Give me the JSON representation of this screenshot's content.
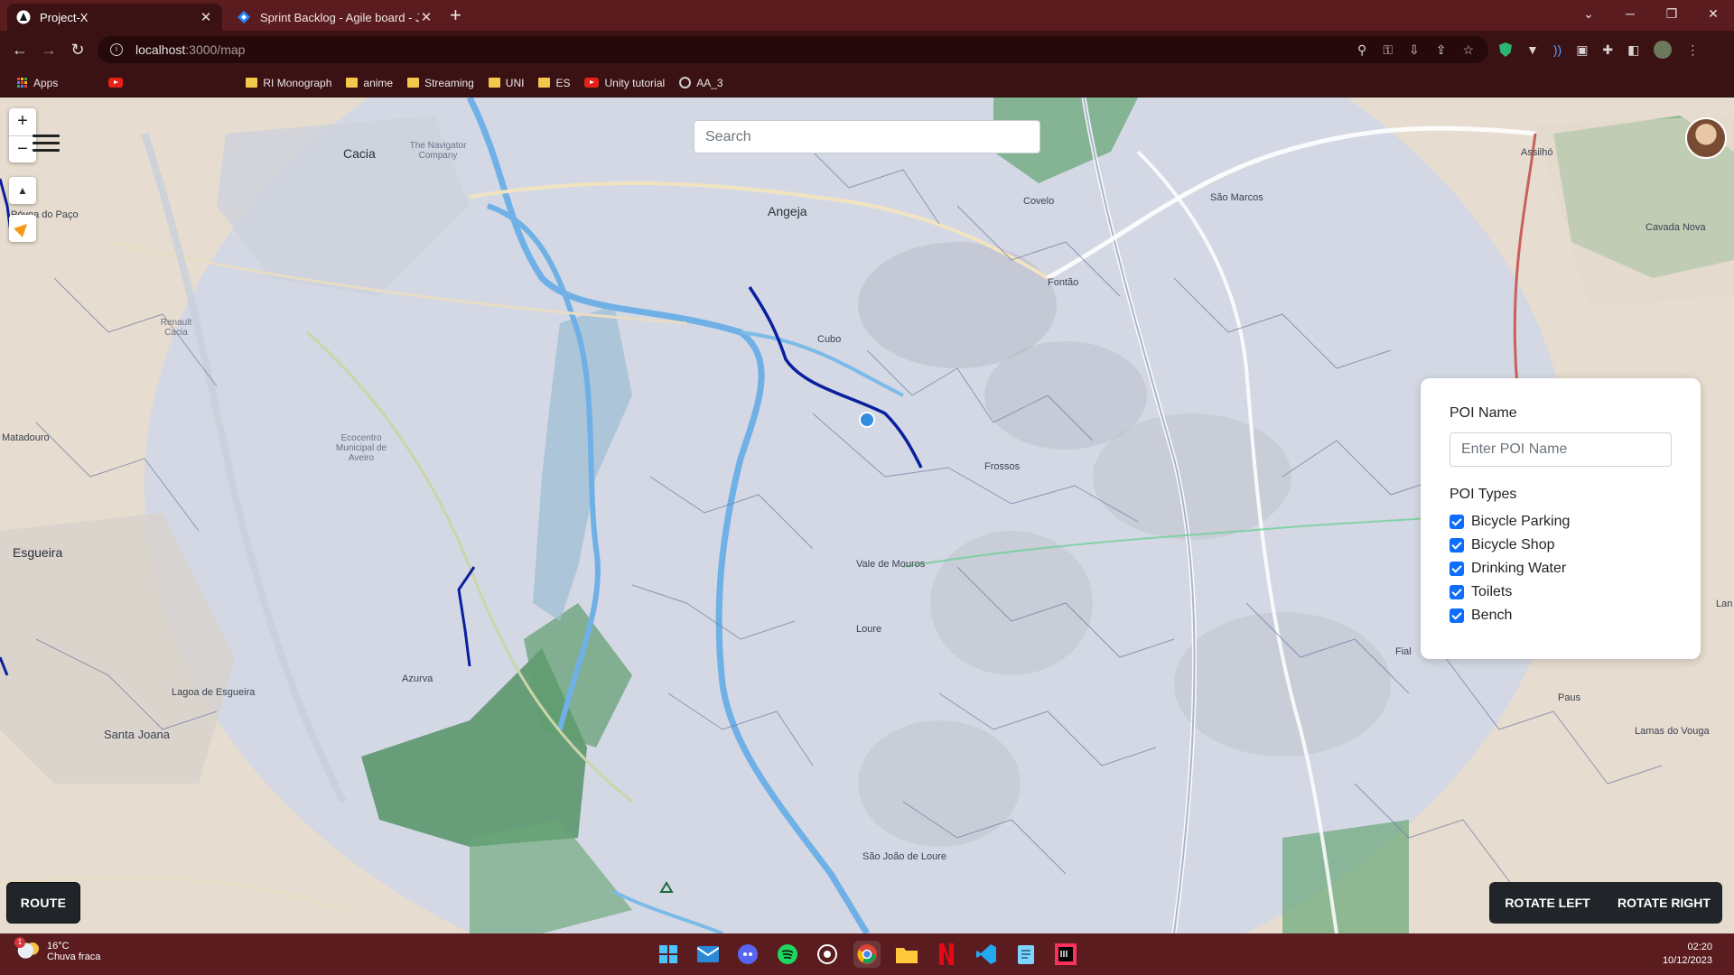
{
  "browser": {
    "tabs": [
      {
        "title": "Project-X",
        "active": true
      },
      {
        "title": "Sprint Backlog - Agile board - Ji",
        "active": false
      }
    ],
    "url_host": "localhost",
    "url_path": ":3000/map",
    "bookmarks": [
      "Apps",
      "RI Monograph",
      "anime",
      "Streaming",
      "UNI",
      "ES",
      "Unity tutorial",
      "AA_3"
    ]
  },
  "map": {
    "search_placeholder": "Search",
    "place_labels": [
      "Cacia",
      "Angeja",
      "Frossos",
      "Cubo",
      "Fontão",
      "Covelo",
      "São Marcos",
      "Assilhó",
      "Cavada Nova",
      "Póvoa do Paço",
      "Esgueira",
      "Matadouro",
      "Vale de Mouros",
      "Loure",
      "São João de Loure",
      "Azurva",
      "Lagoa de Esgueira",
      "Santa Joana",
      "Paus",
      "Lamas do Vouga",
      "Fial",
      "Ecocentro Municipal de Aveiro",
      "The Navigator Company",
      "Renault Cacia",
      "Lan"
    ],
    "zoom_in_label": "+",
    "zoom_out_label": "−",
    "compass_label": "▲"
  },
  "poi_panel": {
    "name_label": "POI Name",
    "name_placeholder": "Enter POI Name",
    "types_label": "POI Types",
    "types": [
      {
        "label": "Bicycle Parking",
        "checked": true
      },
      {
        "label": "Bicycle Shop",
        "checked": true
      },
      {
        "label": "Drinking Water",
        "checked": true
      },
      {
        "label": "Toilets",
        "checked": true
      },
      {
        "label": "Bench",
        "checked": true
      }
    ]
  },
  "buttons": {
    "route": "ROUTE",
    "rotate_left": "ROTATE LEFT",
    "rotate_right": "ROTATE RIGHT"
  },
  "taskbar": {
    "weather_temp": "16°C",
    "weather_desc": "Chuva fraca",
    "weather_badge": "1",
    "time": "02:20",
    "date": "10/12/2023"
  },
  "colors": {
    "chrome_frame": "#5b1c1f",
    "route_line": "#0a1f9e",
    "river": "#6fb0e6",
    "forest": "#5f9e6e",
    "accent": "#0d6efd"
  }
}
